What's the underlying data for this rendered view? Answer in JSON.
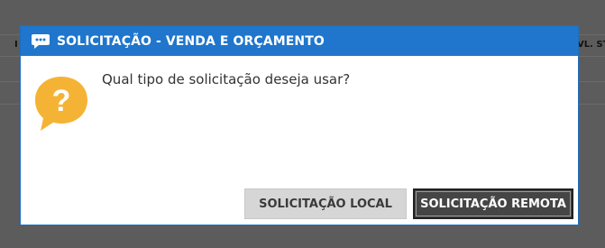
{
  "background": {
    "left_col_fragment": "I",
    "right_col_fragment": "VL. ST"
  },
  "dialog": {
    "title": "SOLICITAÇÃO - VENDA E ORÇAMENTO",
    "title_icon": "chat-bubble-icon",
    "message_icon": "question-bubble-icon",
    "message": "Qual tipo de solicitação deseja usar?",
    "buttons": {
      "local": "SOLICITAÇÃO LOCAL",
      "remote": "SOLICITAÇÃO REMOTA"
    }
  },
  "colors": {
    "titlebar": "#1f76cc",
    "overlay": "#5c5c5c",
    "question_icon": "#f5b335",
    "primary_button": "#454545",
    "secondary_button": "#d6d6d6"
  }
}
